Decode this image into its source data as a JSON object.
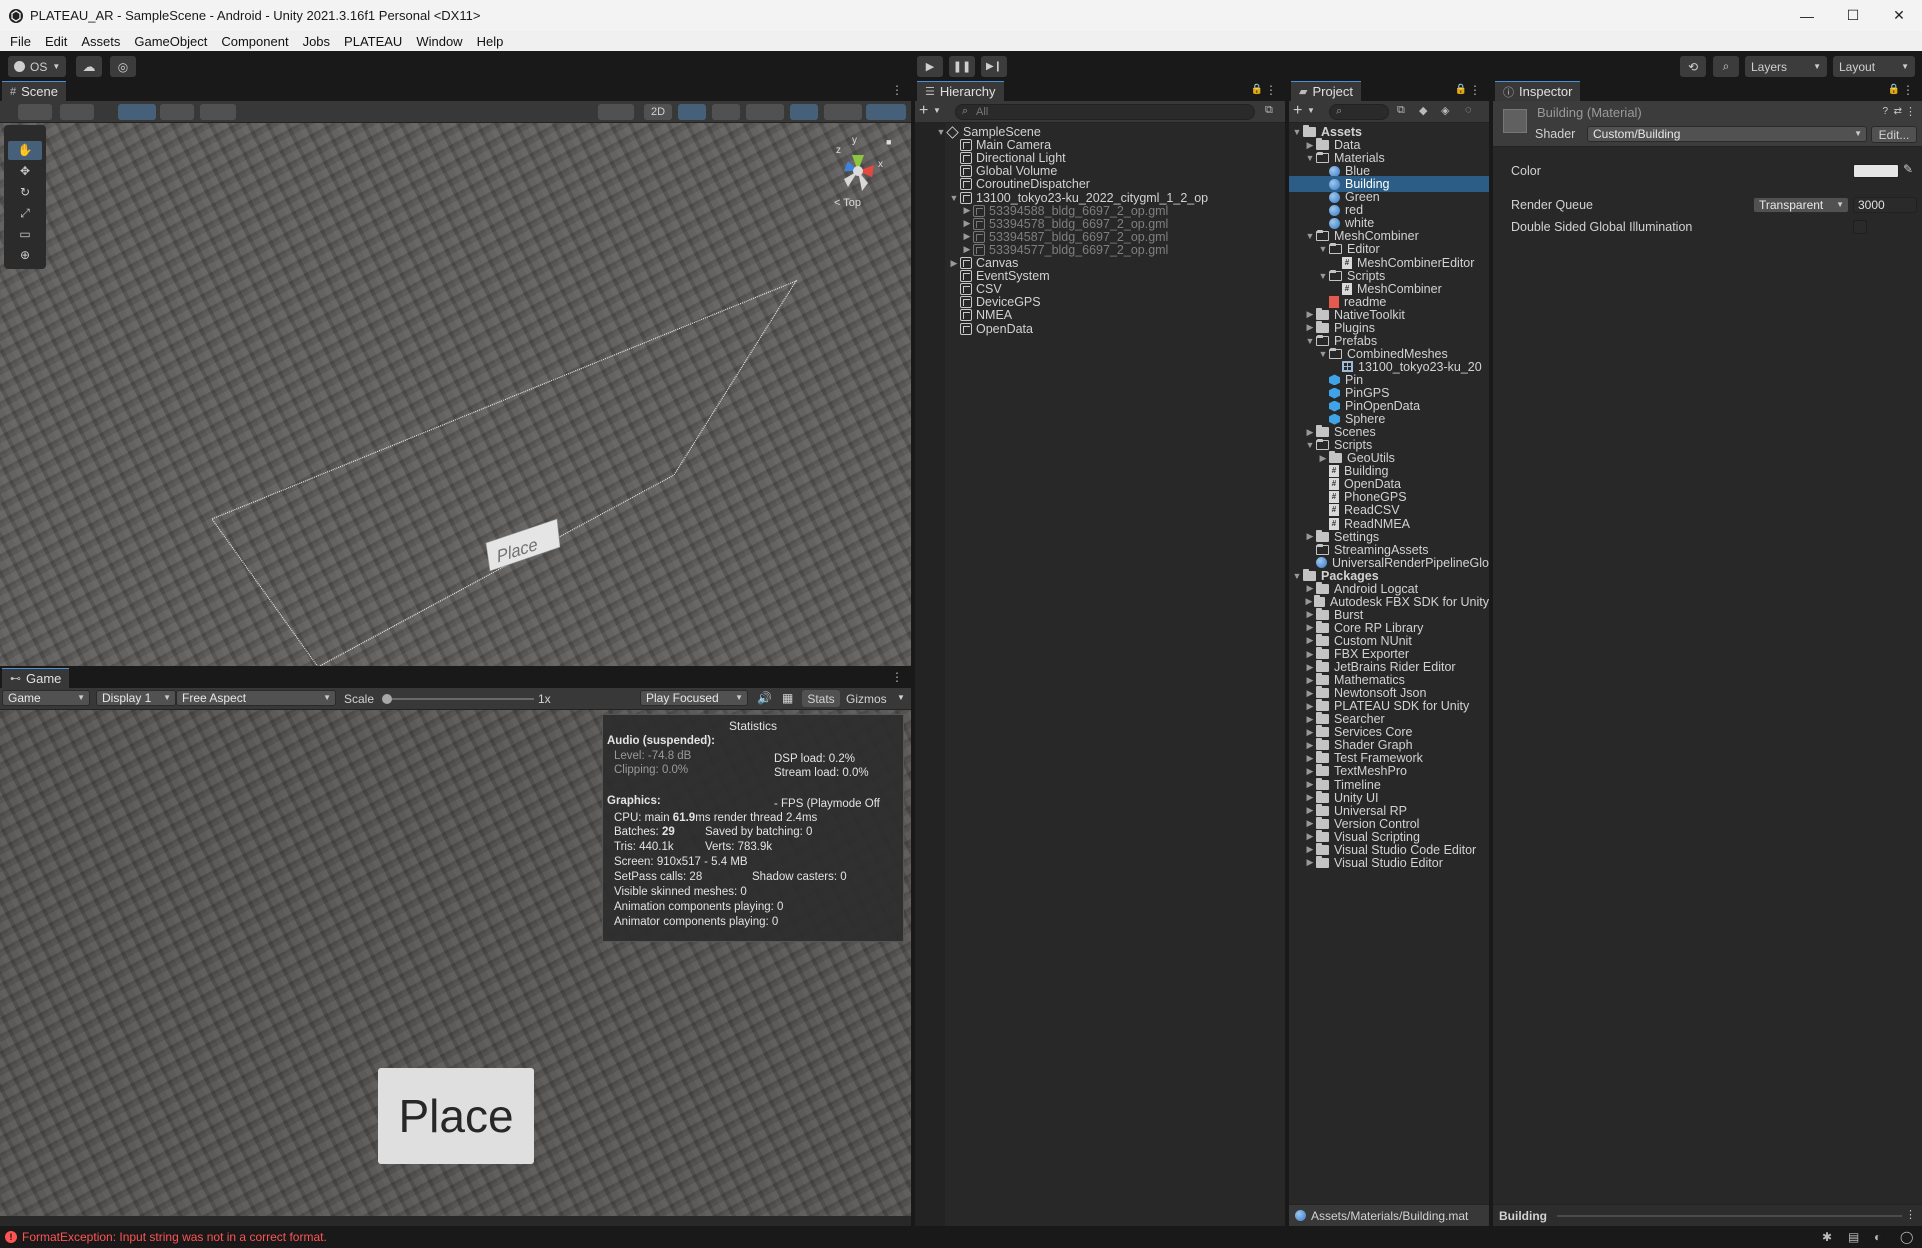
{
  "window": {
    "title": "PLATEAU_AR - SampleScene - Android - Unity 2021.3.16f1 Personal <DX11>",
    "controls": {
      "minimize": "—",
      "maximize": "☐",
      "close": "✕"
    }
  },
  "menu": [
    "File",
    "Edit",
    "Assets",
    "GameObject",
    "Component",
    "Jobs",
    "PLATEAU",
    "Window",
    "Help"
  ],
  "toolbar": {
    "account_label": "OS",
    "layers_label": "Layers",
    "layout_label": "Layout"
  },
  "scene": {
    "tab_label": "Scene",
    "mode_2d": "2D",
    "gizmo_label": "< Top",
    "gizmo_axes": {
      "y": "y",
      "z": "z",
      "x": "x"
    },
    "place_label": "Place"
  },
  "game": {
    "tab_label": "Game",
    "view_select": "Game",
    "display_select": "Display 1",
    "aspect_select": "Free Aspect",
    "scale_label": "Scale",
    "scale_value": "1x",
    "play_mode_select": "Play Focused",
    "stats_label": "Stats",
    "gizmos_label": "Gizmos",
    "place_button": "Place",
    "stats": {
      "heading": "Statistics",
      "audio_heading": "Audio (suspended):",
      "level": "Level: -74.8 dB",
      "clipping": "Clipping: 0.0%",
      "dsp": "DSP load: 0.2%",
      "stream": "Stream load: 0.0%",
      "graphics_heading": "Graphics:",
      "fps": "- FPS (Playmode Off",
      "cpu_prefix": "CPU: main ",
      "cpu_main": "61.9",
      "cpu_suffix": "ms  render thread 2.4ms",
      "batches_prefix": "Batches: ",
      "batches_value": "29",
      "saved_batching": "Saved by batching: 0",
      "tris": "Tris: 440.1k",
      "verts": "Verts: 783.9k",
      "screen": "Screen: 910x517 - 5.4 MB",
      "setpass": "SetPass calls: 28",
      "shadow": "Shadow casters: 0",
      "skinned": "Visible skinned meshes: 0",
      "anim": "Animation components playing: 0",
      "animator": "Animator components playing: 0"
    }
  },
  "hierarchy": {
    "tab_label": "Hierarchy",
    "search_placeholder": "All",
    "items": [
      {
        "label": "SampleScene",
        "depth": 0,
        "kind": "scene",
        "fold": "open"
      },
      {
        "label": "Main Camera",
        "depth": 1,
        "kind": "go"
      },
      {
        "label": "Directional Light",
        "depth": 1,
        "kind": "go"
      },
      {
        "label": "Global Volume",
        "depth": 1,
        "kind": "go"
      },
      {
        "label": "CoroutineDispatcher",
        "depth": 1,
        "kind": "go"
      },
      {
        "label": "13100_tokyo23-ku_2022_citygml_1_2_op",
        "depth": 1,
        "kind": "go",
        "fold": "open"
      },
      {
        "label": "53394588_bldg_6697_2_op.gml",
        "depth": 2,
        "kind": "go",
        "fold": "closed",
        "dim": true
      },
      {
        "label": "53394578_bldg_6697_2_op.gml",
        "depth": 2,
        "kind": "go",
        "fold": "closed",
        "dim": true
      },
      {
        "label": "53394587_bldg_6697_2_op.gml",
        "depth": 2,
        "kind": "go",
        "fold": "closed",
        "dim": true
      },
      {
        "label": "53394577_bldg_6697_2_op.gml",
        "depth": 2,
        "kind": "go",
        "fold": "closed",
        "dim": true
      },
      {
        "label": "Canvas",
        "depth": 1,
        "kind": "go",
        "fold": "closed"
      },
      {
        "label": "EventSystem",
        "depth": 1,
        "kind": "go"
      },
      {
        "label": "CSV",
        "depth": 1,
        "kind": "go"
      },
      {
        "label": "DeviceGPS",
        "depth": 1,
        "kind": "go"
      },
      {
        "label": "NMEA",
        "depth": 1,
        "kind": "go"
      },
      {
        "label": "OpenData",
        "depth": 1,
        "kind": "go"
      }
    ]
  },
  "project": {
    "tab_label": "Project",
    "footer_path": "Assets/Materials/Building.mat",
    "items": [
      {
        "label": "Assets",
        "depth": 0,
        "kind": "folder",
        "fold": "open",
        "bold": true
      },
      {
        "label": "Data",
        "depth": 1,
        "kind": "folder",
        "fold": "closed"
      },
      {
        "label": "Materials",
        "depth": 1,
        "kind": "folder-open",
        "fold": "open"
      },
      {
        "label": "Blue",
        "depth": 2,
        "kind": "material"
      },
      {
        "label": "Building",
        "depth": 2,
        "kind": "material",
        "selected": true
      },
      {
        "label": "Green",
        "depth": 2,
        "kind": "material"
      },
      {
        "label": "red",
        "depth": 2,
        "kind": "material"
      },
      {
        "label": "white",
        "depth": 2,
        "kind": "material"
      },
      {
        "label": "MeshCombiner",
        "depth": 1,
        "kind": "folder-open",
        "fold": "open"
      },
      {
        "label": "Editor",
        "depth": 2,
        "kind": "folder-open",
        "fold": "open"
      },
      {
        "label": "MeshCombinerEditor",
        "depth": 3,
        "kind": "script"
      },
      {
        "label": "Scripts",
        "depth": 2,
        "kind": "folder-open",
        "fold": "open"
      },
      {
        "label": "MeshCombiner",
        "depth": 3,
        "kind": "script"
      },
      {
        "label": "readme",
        "depth": 2,
        "kind": "readme"
      },
      {
        "label": "NativeToolkit",
        "depth": 1,
        "kind": "folder",
        "fold": "closed"
      },
      {
        "label": "Plugins",
        "depth": 1,
        "kind": "folder",
        "fold": "closed"
      },
      {
        "label": "Prefabs",
        "depth": 1,
        "kind": "folder-open",
        "fold": "open"
      },
      {
        "label": "CombinedMeshes",
        "depth": 2,
        "kind": "folder-open",
        "fold": "open"
      },
      {
        "label": "13100_tokyo23-ku_20",
        "depth": 3,
        "kind": "mesh"
      },
      {
        "label": "Pin",
        "depth": 2,
        "kind": "prefab"
      },
      {
        "label": "PinGPS",
        "depth": 2,
        "kind": "prefab"
      },
      {
        "label": "PinOpenData",
        "depth": 2,
        "kind": "prefab"
      },
      {
        "label": "Sphere",
        "depth": 2,
        "kind": "prefab"
      },
      {
        "label": "Scenes",
        "depth": 1,
        "kind": "folder",
        "fold": "closed"
      },
      {
        "label": "Scripts",
        "depth": 1,
        "kind": "folder-open",
        "fold": "open"
      },
      {
        "label": "GeoUtils",
        "depth": 2,
        "kind": "folder",
        "fold": "closed"
      },
      {
        "label": "Building",
        "depth": 2,
        "kind": "script"
      },
      {
        "label": "OpenData",
        "depth": 2,
        "kind": "script"
      },
      {
        "label": "PhoneGPS",
        "depth": 2,
        "kind": "script"
      },
      {
        "label": "ReadCSV",
        "depth": 2,
        "kind": "script"
      },
      {
        "label": "ReadNMEA",
        "depth": 2,
        "kind": "script"
      },
      {
        "label": "Settings",
        "depth": 1,
        "kind": "folder",
        "fold": "closed"
      },
      {
        "label": "StreamingAssets",
        "depth": 1,
        "kind": "folder-open"
      },
      {
        "label": "UniversalRenderPipelineGlo",
        "depth": 1,
        "kind": "asset"
      },
      {
        "label": "Packages",
        "depth": 0,
        "kind": "folder",
        "fold": "open",
        "bold": true
      },
      {
        "label": "Android Logcat",
        "depth": 1,
        "kind": "folder",
        "fold": "closed"
      },
      {
        "label": "Autodesk FBX SDK for Unity",
        "depth": 1,
        "kind": "folder",
        "fold": "closed"
      },
      {
        "label": "Burst",
        "depth": 1,
        "kind": "folder",
        "fold": "closed"
      },
      {
        "label": "Core RP Library",
        "depth": 1,
        "kind": "folder",
        "fold": "closed"
      },
      {
        "label": "Custom NUnit",
        "depth": 1,
        "kind": "folder",
        "fold": "closed"
      },
      {
        "label": "FBX Exporter",
        "depth": 1,
        "kind": "folder",
        "fold": "closed"
      },
      {
        "label": "JetBrains Rider Editor",
        "depth": 1,
        "kind": "folder",
        "fold": "closed"
      },
      {
        "label": "Mathematics",
        "depth": 1,
        "kind": "folder",
        "fold": "closed"
      },
      {
        "label": "Newtonsoft Json",
        "depth": 1,
        "kind": "folder",
        "fold": "closed"
      },
      {
        "label": "PLATEAU SDK for Unity",
        "depth": 1,
        "kind": "folder",
        "fold": "closed"
      },
      {
        "label": "Searcher",
        "depth": 1,
        "kind": "folder",
        "fold": "closed"
      },
      {
        "label": "Services Core",
        "depth": 1,
        "kind": "folder",
        "fold": "closed"
      },
      {
        "label": "Shader Graph",
        "depth": 1,
        "kind": "folder",
        "fold": "closed"
      },
      {
        "label": "Test Framework",
        "depth": 1,
        "kind": "folder",
        "fold": "closed"
      },
      {
        "label": "TextMeshPro",
        "depth": 1,
        "kind": "folder",
        "fold": "closed"
      },
      {
        "label": "Timeline",
        "depth": 1,
        "kind": "folder",
        "fold": "closed"
      },
      {
        "label": "Unity UI",
        "depth": 1,
        "kind": "folder",
        "fold": "closed"
      },
      {
        "label": "Universal RP",
        "depth": 1,
        "kind": "folder",
        "fold": "closed"
      },
      {
        "label": "Version Control",
        "depth": 1,
        "kind": "folder",
        "fold": "closed"
      },
      {
        "label": "Visual Scripting",
        "depth": 1,
        "kind": "folder",
        "fold": "closed"
      },
      {
        "label": "Visual Studio Code Editor",
        "depth": 1,
        "kind": "folder",
        "fold": "closed"
      },
      {
        "label": "Visual Studio Editor",
        "depth": 1,
        "kind": "folder",
        "fold": "closed"
      }
    ]
  },
  "inspector": {
    "tab_label": "Inspector",
    "object_title": "Building (Material)",
    "shader_label": "Shader",
    "shader_value": "Custom/Building",
    "edit_button": "Edit...",
    "color_label": "Color",
    "color_value": "#e6e6e6",
    "render_queue_label": "Render Queue",
    "render_queue_mode": "Transparent",
    "render_queue_value": "3000",
    "dsgi_label": "Double Sided Global Illumination",
    "footer_label": "Building"
  },
  "status": {
    "error": "FormatException: Input string was not in a correct format.",
    "error_color": "#ff5454"
  },
  "colors": {
    "selection": "#2c5d87",
    "panel": "#282828",
    "header": "#383838"
  }
}
